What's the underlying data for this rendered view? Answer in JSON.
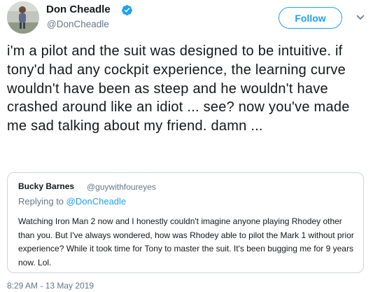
{
  "tweet": {
    "author": {
      "name": "Don Cheadle",
      "handle": "@DonCheadle",
      "verified": true
    },
    "follow_label": "Follow",
    "text": "i'm a pilot and the suit was designed to be intuitive. if tony'd had any cockpit experience, the learning curve wouldn't have been as steep and he wouldn't have crashed around like an idiot ... see? now you've made me sad talking about my friend. damn ...",
    "timestamp": "8:29 AM - 13 May 2019"
  },
  "quoted_tweet": {
    "author_name": "Bucky Barnes",
    "author_handle": "@guywithfoureyes",
    "replying_prefix": "Replying to",
    "replying_to": "@DonCheadle",
    "text": "Watching Iron Man 2 now and I honestly couldn't imagine anyone playing Rhodey other than you. But I've always wondered, how was Rhodey able to pilot the Mark 1 without prior experience? While it took time for Tony to master the suit. It's been bugging me for 9 years now. Lol."
  },
  "colors": {
    "accent": "#1da1f2",
    "secondary_text": "#657786",
    "primary_text": "#14171a",
    "border": "#ccd6dd"
  },
  "icons": {
    "verified": "verified-badge-icon",
    "caret": "chevron-down-icon"
  }
}
